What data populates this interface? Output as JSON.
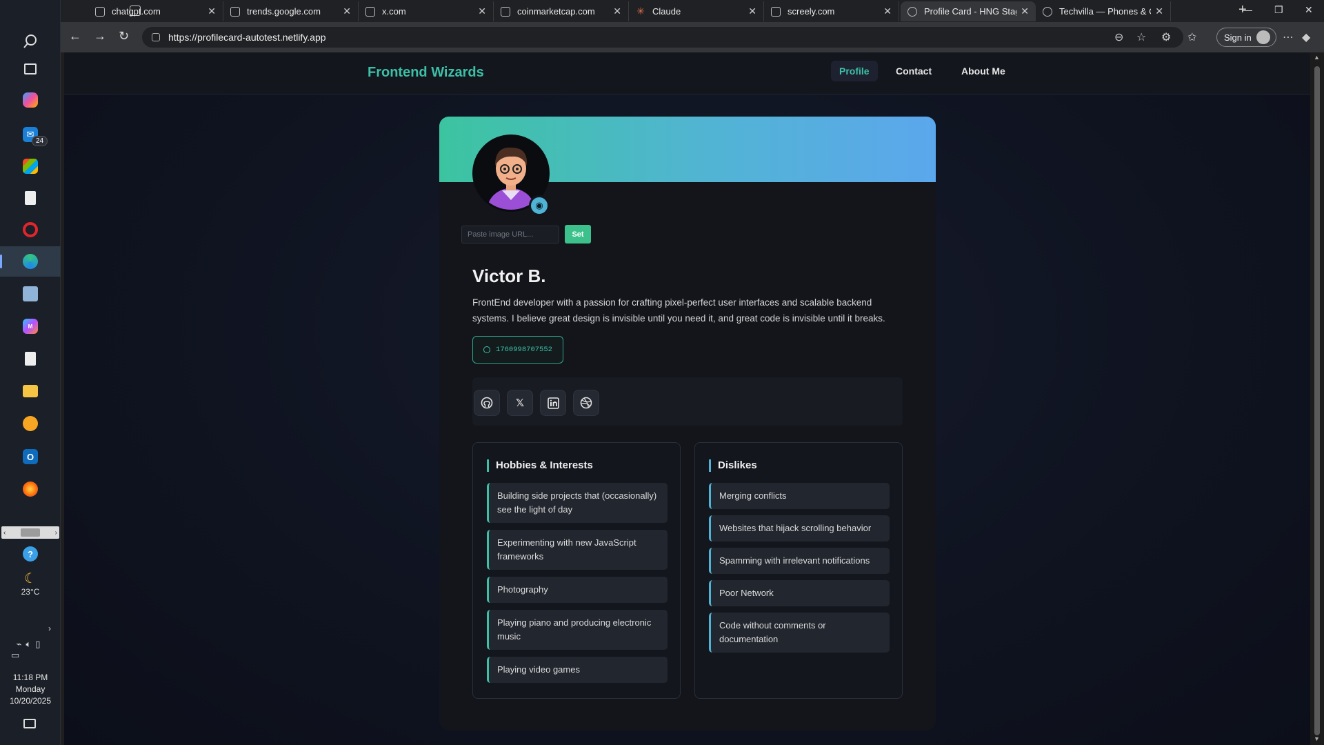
{
  "browser": {
    "tabs": [
      {
        "title": "chatgpt.com",
        "active": false
      },
      {
        "title": "trends.google.com",
        "active": false
      },
      {
        "title": "x.com",
        "active": false
      },
      {
        "title": "coinmarketcap.com",
        "active": false
      },
      {
        "title": "Claude",
        "active": false
      },
      {
        "title": "screely.com",
        "active": false
      },
      {
        "title": "Profile Card - HNG Stage",
        "active": true
      },
      {
        "title": "Techvilla — Phones & Ga",
        "active": false
      }
    ],
    "url": "https://profilecard-autotest.netlify.app",
    "sign_in_label": "Sign in"
  },
  "taskbar": {
    "mail_badge": "24",
    "weather_temp": "23°C",
    "clock_time": "11:18 PM",
    "clock_day": "Monday",
    "clock_date": "10/20/2025"
  },
  "site": {
    "brand": "Frontend Wizards",
    "nav": [
      {
        "label": "Profile",
        "active": true
      },
      {
        "label": "Contact",
        "active": false
      },
      {
        "label": "About Me",
        "active": false
      }
    ]
  },
  "profile": {
    "avatar_url_placeholder": "Paste image URL...",
    "set_button": "Set",
    "name": "Victor B.",
    "bio": "FrontEnd developer with a passion for crafting pixel-perfect user interfaces and scalable backend systems. I believe great design is invisible until you need it, and great code is invisible until it breaks.",
    "timestamp": "1760998707552",
    "social": [
      {
        "name": "github-icon"
      },
      {
        "name": "x-icon"
      },
      {
        "name": "linkedin-icon"
      },
      {
        "name": "dribbble-icon"
      }
    ],
    "hobbies_title": "Hobbies & Interests",
    "hobbies": [
      "Building side projects that (occasionally) see the light of day",
      "Experimenting with new JavaScript frameworks",
      "Photography",
      "Playing piano and producing electronic music",
      "Playing video games"
    ],
    "dislikes_title": "Dislikes",
    "dislikes": [
      "Merging conflicts",
      "Websites that hijack scrolling behavior",
      "Spamming with irrelevant notifications",
      "Poor Network",
      "Code without comments or documentation"
    ]
  },
  "colors": {
    "accent": "#3cc0a8",
    "accent_blue": "#4fb3d6",
    "page_bg": "#0f1320"
  }
}
